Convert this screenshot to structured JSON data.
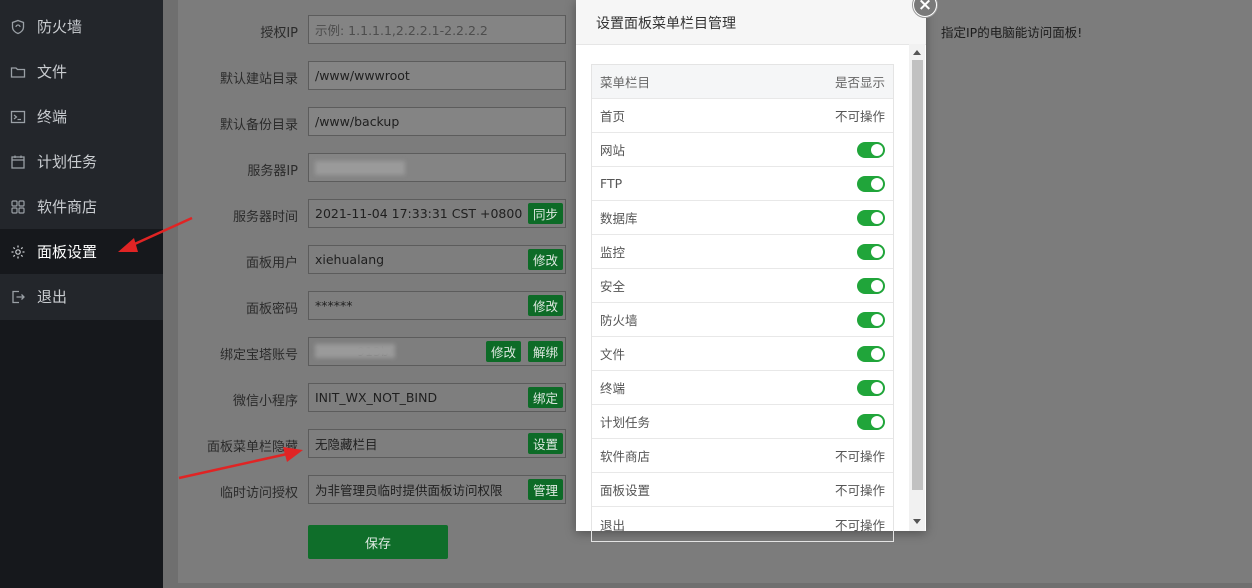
{
  "sidebar": {
    "items": [
      {
        "label": "防火墙",
        "icon": "shield-icon"
      },
      {
        "label": "文件",
        "icon": "folder-icon"
      },
      {
        "label": "终端",
        "icon": "terminal-icon"
      },
      {
        "label": "计划任务",
        "icon": "calendar-icon"
      },
      {
        "label": "软件商店",
        "icon": "grid-icon"
      },
      {
        "label": "面板设置",
        "icon": "gear-icon"
      },
      {
        "label": "退出",
        "icon": "logout-icon"
      }
    ]
  },
  "form": {
    "auth_ip": {
      "label": "授权IP",
      "placeholder": "示例: 1.1.1.1,2.2.2.1-2.2.2.2"
    },
    "site_dir": {
      "label": "默认建站目录",
      "value": "/www/wwwroot"
    },
    "backup_dir": {
      "label": "默认备份目录",
      "value": "/www/backup"
    },
    "server_ip": {
      "label": "服务器IP"
    },
    "server_time": {
      "label": "服务器时间",
      "value": "2021-11-04 17:33:31 CST +0800",
      "button": "同步"
    },
    "panel_user": {
      "label": "面板用户",
      "value": "xiehualang",
      "button": "修改"
    },
    "panel_password": {
      "label": "面板密码",
      "value": "******",
      "button": "修改"
    },
    "bt_account": {
      "label": "绑定宝塔账号",
      "value": "913b",
      "button_edit": "修改",
      "button_unbind": "解绑"
    },
    "wechat": {
      "label": "微信小程序",
      "value": "INIT_WX_NOT_BIND",
      "button": "绑定"
    },
    "menu_hide": {
      "label": "面板菜单栏隐藏",
      "value": "无隐藏栏目",
      "button": "设置"
    },
    "temp_access": {
      "label": "临时访问授权",
      "value": "为非管理员临时提供面板访问权限",
      "button": "管理"
    },
    "save_label": "保存",
    "right_note": "指定IP的电脑能访问面板!"
  },
  "modal": {
    "title": "设置面板菜单栏目管理",
    "close_label": "×",
    "header": {
      "col1": "菜单栏目",
      "col2": "是否显示"
    },
    "rows": [
      {
        "name": "首页",
        "status": "不可操作"
      },
      {
        "name": "网站",
        "toggle": true
      },
      {
        "name": "FTP",
        "toggle": true
      },
      {
        "name": "数据库",
        "toggle": true
      },
      {
        "name": "监控",
        "toggle": true
      },
      {
        "name": "安全",
        "toggle": true
      },
      {
        "name": "防火墙",
        "toggle": true
      },
      {
        "name": "文件",
        "toggle": true
      },
      {
        "name": "终端",
        "toggle": true
      },
      {
        "name": "计划任务",
        "toggle": true
      },
      {
        "name": "软件商店",
        "status": "不可操作"
      },
      {
        "name": "面板设置",
        "status": "不可操作"
      },
      {
        "name": "退出",
        "status": "不可操作"
      }
    ]
  },
  "colors": {
    "accent_green": "#20a53a",
    "annotation_red": "#e02424"
  }
}
